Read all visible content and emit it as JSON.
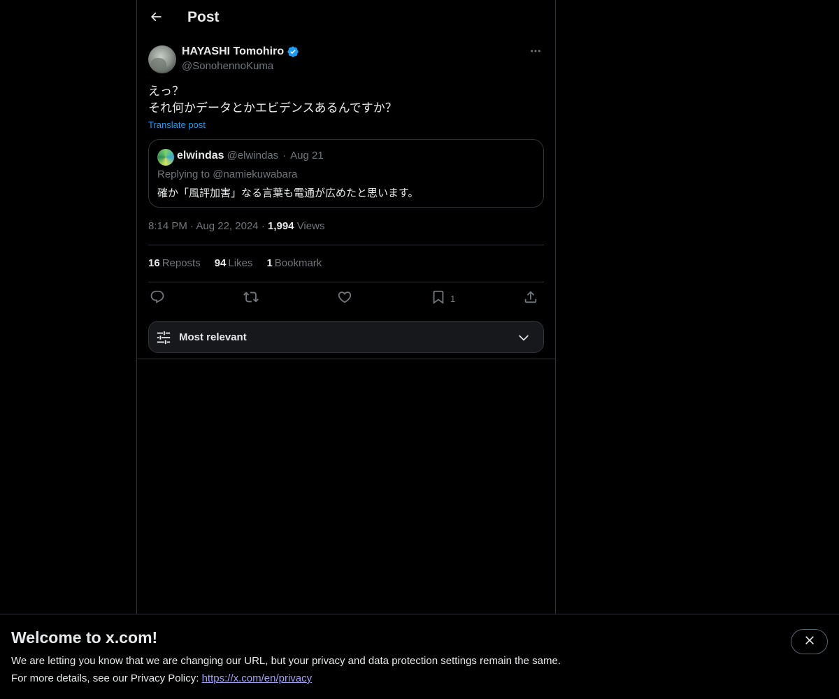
{
  "header": {
    "title": "Post"
  },
  "post": {
    "author_name": "HAYASHI Tomohiro",
    "author_handle": "@SonohennoKuma",
    "text": "えっ？\nそれ何かデータとかエビデンスあるんですか？",
    "translate_label": "Translate post",
    "time": "8:14 PM",
    "date": "Aug 22, 2024",
    "views_count": "1,994",
    "views_label": "Views"
  },
  "quote": {
    "author_name": "elwindas",
    "author_handle": "@elwindas",
    "date": "Aug 21",
    "replying_to": "Replying to @namiekuwabara",
    "text": "確か「風評加害」なる言葉も電通が広めたと思います。"
  },
  "stats": {
    "reposts_count": "16",
    "reposts_label": "Reposts",
    "likes_count": "94",
    "likes_label": "Likes",
    "bookmarks_count": "1",
    "bookmarks_label": "Bookmark"
  },
  "actions": {
    "bookmark_count": "1"
  },
  "sort": {
    "label": "Most relevant"
  },
  "banner": {
    "title": "Welcome to x.com!",
    "line1": "We are letting you know that we are changing our URL, but your privacy and data protection settings remain the same.",
    "line2_prefix": "For more details, see our Privacy Policy: ",
    "link": "https://x.com/en/privacy"
  },
  "colors": {
    "background": "#000000",
    "text": "#e7e9ea",
    "muted": "#71767b",
    "accent": "#1d9bf0",
    "border": "#2f3336",
    "link_purple": "#a39ff5"
  },
  "icons": {
    "back": "arrow-left-icon",
    "verified": "verified-badge-icon",
    "more": "more-horizontal-icon",
    "reply": "reply-icon",
    "repost": "repost-icon",
    "like": "heart-icon",
    "bookmark": "bookmark-icon",
    "share": "share-icon",
    "sort": "sliders-icon",
    "chevron": "chevron-down-icon",
    "close": "close-icon"
  }
}
